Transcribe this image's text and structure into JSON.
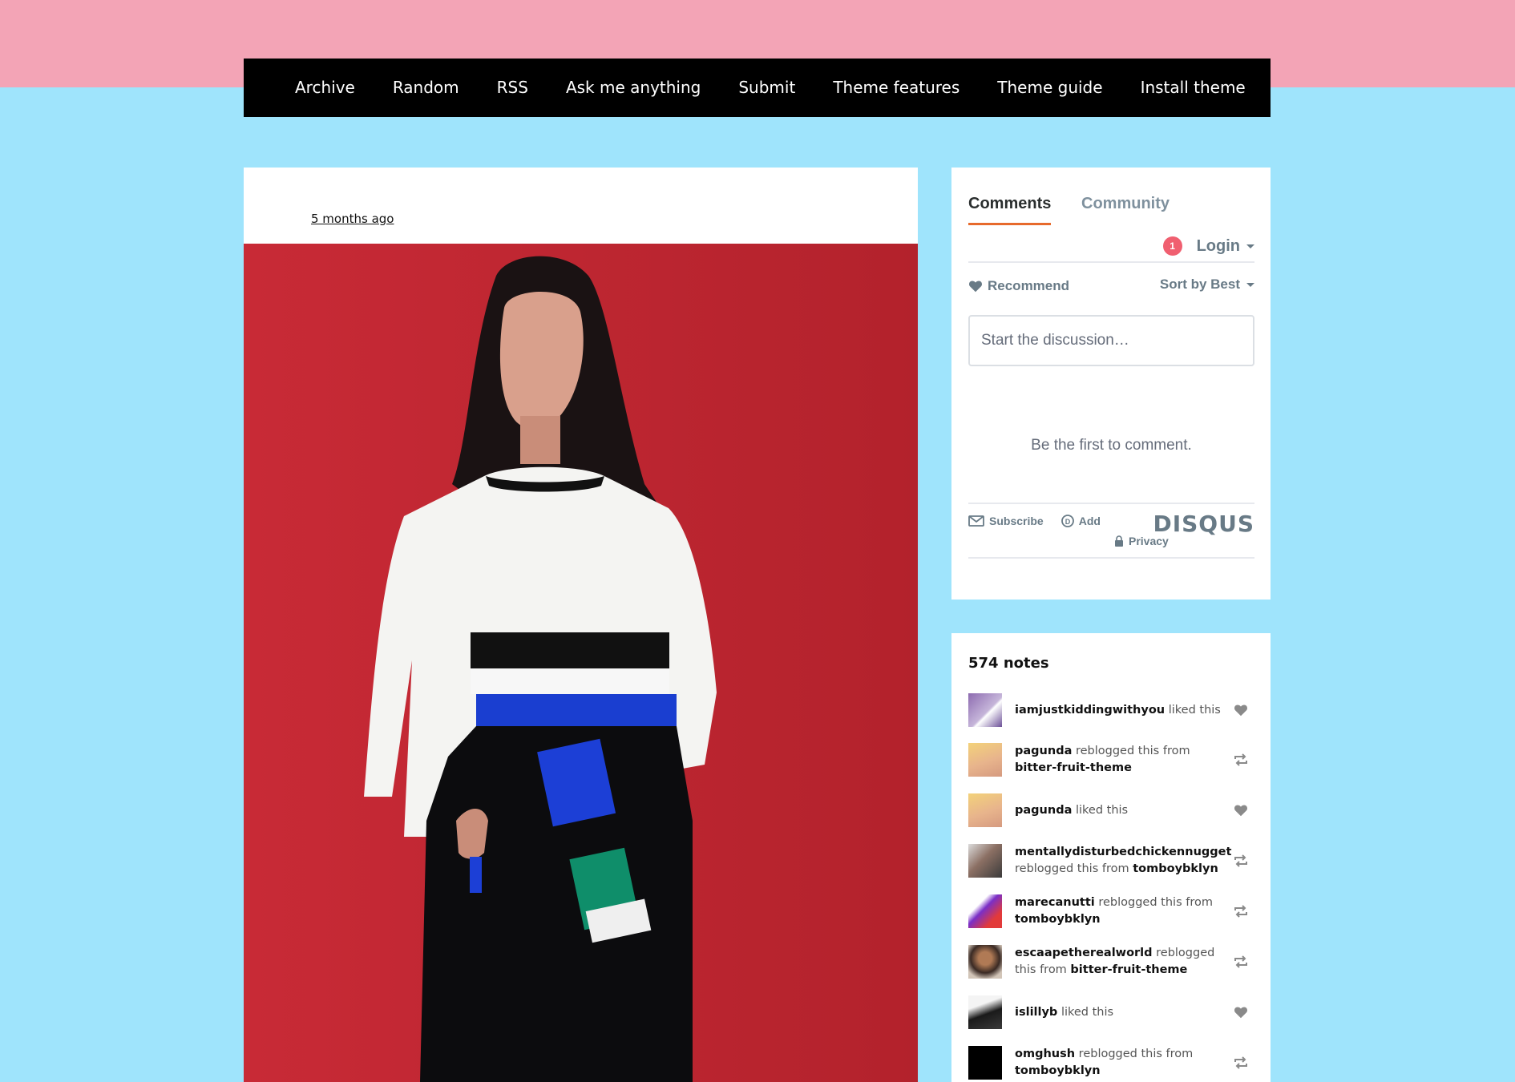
{
  "nav": {
    "items": [
      "Archive",
      "Random",
      "RSS",
      "Ask me anything",
      "Submit",
      "Theme features",
      "Theme guide",
      "Install theme"
    ]
  },
  "post": {
    "time": "5 months ago"
  },
  "disqus": {
    "tabs": {
      "comments": "Comments",
      "community": "Community"
    },
    "notification_count": "1",
    "login": "Login",
    "recommend": "Recommend",
    "sort": "Sort by Best",
    "input_placeholder": "Start the discussion…",
    "empty": "Be the first to comment.",
    "subscribe": "Subscribe",
    "add": "Add",
    "privacy": "Privacy",
    "logo": "DISQUS",
    "accent_color": "#e76a2c"
  },
  "notes": {
    "title": "574 notes",
    "items": [
      {
        "user": "iamjustkiddingwithyou",
        "action": "liked this",
        "from": "",
        "icon": "heart-icon"
      },
      {
        "user": "pagunda",
        "action": "reblogged this from",
        "from": "bitter-fruit-theme",
        "icon": "reblog-icon"
      },
      {
        "user": "pagunda",
        "action": "liked this",
        "from": "",
        "icon": "heart-icon"
      },
      {
        "user": "mentallydisturbedchickennugget",
        "action": "reblogged this from",
        "from": "tomboybklyn",
        "icon": "reblog-icon"
      },
      {
        "user": "marecanutti",
        "action": "reblogged this from",
        "from": "tomboybklyn",
        "icon": "reblog-icon"
      },
      {
        "user": "escaapetherealworld",
        "action": "reblogged this from",
        "from": "bitter-fruit-theme",
        "icon": "reblog-icon"
      },
      {
        "user": "islillyb",
        "action": "liked this",
        "from": "",
        "icon": "heart-icon"
      },
      {
        "user": "omghush",
        "action": "reblogged this from",
        "from": "tomboybklyn",
        "icon": "reblog-icon"
      }
    ]
  },
  "colors": {
    "page_bg": "#9fe4fc",
    "top_band": "#f3a4b6",
    "photo_bg": "#c92a35"
  }
}
